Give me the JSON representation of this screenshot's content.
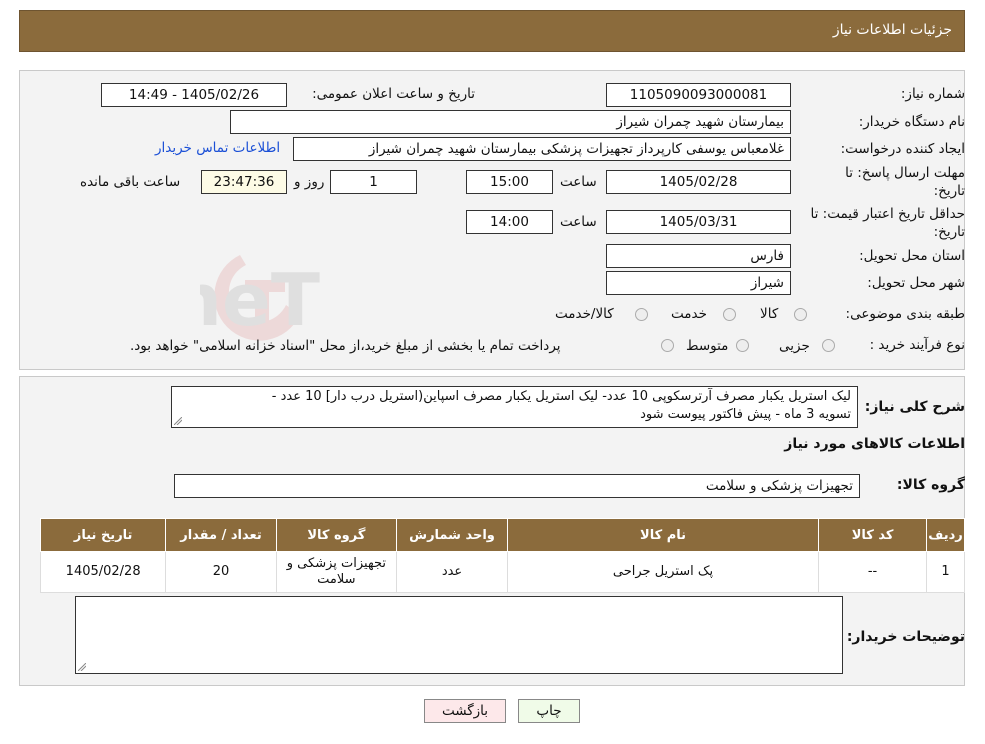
{
  "header": {
    "title": "جزئیات اطلاعات نیاز"
  },
  "fields": {
    "need_number_label": "شماره نیاز:",
    "need_number": "1105090093000081",
    "announce_label": "تاریخ و ساعت اعلان عمومی:",
    "announce_value": "1405/02/26 - 14:49",
    "buyer_org_label": "نام دستگاه خریدار:",
    "buyer_org": "بیمارستان شهید چمران شیراز",
    "creator_label": "ایجاد کننده درخواست:",
    "creator": "غلامعباس  یوسفی کارپرداز تجهیزات پزشکی بیمارستان شهید چمران شیراز",
    "contact_link": "اطلاعات تماس خریدار",
    "deadline_label_1": "مهلت ارسال پاسخ: تا",
    "deadline_label_2": "تاریخ:",
    "deadline_date": "1405/02/28",
    "time_label": "ساعت",
    "deadline_time": "15:00",
    "days_value": "1",
    "days_label": "روز و",
    "remaining_time": "23:47:36",
    "remaining_label": "ساعت باقی مانده",
    "validity_label_1": "حداقل تاریخ اعتبار قیمت: تا",
    "validity_label_2": "تاریخ:",
    "validity_date": "1405/03/31",
    "validity_time": "14:00",
    "province_label": "استان محل تحویل:",
    "province": "فارس",
    "city_label": "شهر محل تحویل:",
    "city": "شیراز",
    "category_label": "طبقه بندی موضوعی:",
    "category_opt1": "کالا",
    "category_opt2": "خدمت",
    "category_opt3": "کالا/خدمت",
    "process_label": "نوع فرآیند خرید :",
    "process_opt1": "جزیی",
    "process_opt2": "متوسط",
    "process_note": "پرداخت تمام یا بخشی از مبلغ خرید،از محل \"اسناد خزانه اسلامی\" خواهد بود."
  },
  "summary": {
    "label": "شرح کلی نیاز:",
    "line1": "لیک استریل یکبار مصرف آرترسکوپی 10 عدد- لیک استریل یکبار مصرف اسپاین(استریل درب دار] 10 عدد  -",
    "line2": "تسویه 3 ماه - پیش فاکتور پیوست شود"
  },
  "goods": {
    "section_title": "اطلاعات کالاهای مورد نیاز",
    "group_label": "گروه کالا:",
    "group_value": "تجهیزات پزشکی و سلامت",
    "columns": [
      "ردیف",
      "کد کالا",
      "نام کالا",
      "واحد شمارش",
      "گروه کالا",
      "تعداد / مقدار",
      "تاریخ نیاز"
    ],
    "rows": [
      {
        "row": "1",
        "code": "--",
        "name": "پک استریل جراحی",
        "unit": "عدد",
        "group": "تجهیزات پزشکی و سلامت",
        "qty": "20",
        "date": "1405/02/28"
      }
    ]
  },
  "buyer_notes": {
    "label": "توضیحات خریدار:",
    "value": ""
  },
  "buttons": {
    "print": "چاپ",
    "back": "بازگشت"
  },
  "watermark": {
    "text": "AriaTender.neT"
  }
}
